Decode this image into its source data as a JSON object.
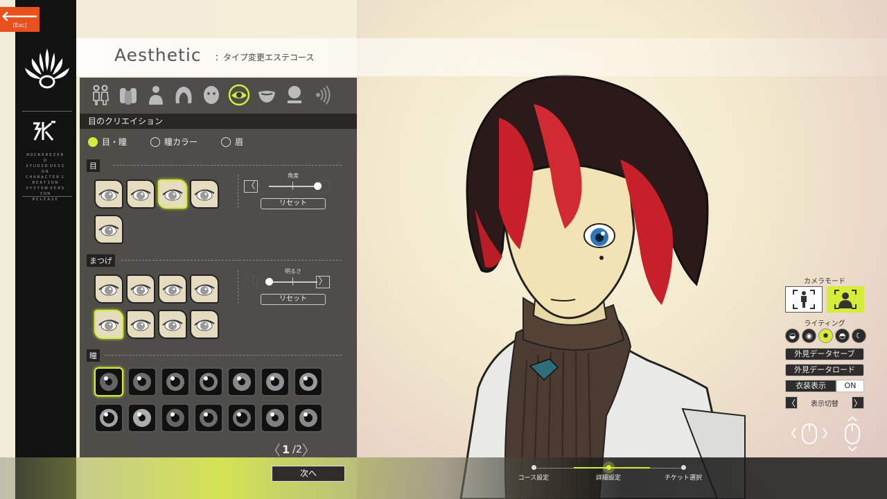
{
  "nav": {
    "back_arrow": "🡐",
    "back_label": "[Esc]"
  },
  "company": {
    "lines": [
      "ＲＯＣＫＥＲＥＺＥＲＯ",
      "ＳＴＵＤＩＯ ＤＥＳＩＧＮ",
      "ＣＨＡＲＡＣＴＥＲ ＣＲＥＡＴＩＯＮ",
      "ＳＹＳＴＥＭ ＶＥＲＳＩＯＮ",
      "ＲＥＬＥＡＳＥ"
    ]
  },
  "header": {
    "title": "Aesthetic",
    "subtitle": "：タイプ変更エステコース"
  },
  "categories": [
    {
      "icon": "couple-icon"
    },
    {
      "icon": "group-icon"
    },
    {
      "icon": "body-icon"
    },
    {
      "icon": "hair-icon"
    },
    {
      "icon": "face-icon"
    },
    {
      "icon": "eye-icon",
      "active": true
    },
    {
      "icon": "mouth-icon"
    },
    {
      "icon": "makeup-icon"
    },
    {
      "icon": "voice-icon"
    }
  ],
  "panel": {
    "section_title": "目のクリエイション",
    "radios": [
      {
        "label": "目・瞳",
        "checked": true
      },
      {
        "label": "瞳カラー",
        "checked": false
      },
      {
        "label": "眉",
        "checked": false
      }
    ],
    "eye": {
      "label": "目",
      "slider_label": "角度",
      "slider_value": 1.0,
      "reset": "リセット",
      "selected_index": 2
    },
    "lashes": {
      "label": "まつげ",
      "slider_label": "明るさ",
      "slider_value": 0.0,
      "reset": "リセット",
      "selected_index": 4
    },
    "pupil": {
      "label": "瞳",
      "selected_index": 0
    },
    "pager": {
      "current": "1",
      "total": "/2",
      "prev": "〈",
      "next": "〉"
    }
  },
  "right_controls": {
    "camera_label": "カメラモード",
    "lighting_label": "ライティング",
    "save_button": "外見データセーブ",
    "load_button": "外見データロード",
    "outfit_label": "衣装表示",
    "outfit_value": "ON",
    "switch_label": "表示切替",
    "switch_prev": "〈",
    "switch_next": "〉"
  },
  "bottom": {
    "next_button": "次へ",
    "steps": [
      {
        "label": "コース設定",
        "active": false
      },
      {
        "label": "詳細設定",
        "active": true
      },
      {
        "label": "チケット選択",
        "active": false
      }
    ]
  },
  "colors": {
    "accent": "#d6ec3a",
    "esc": "#e8501e",
    "panel": "#383734"
  }
}
